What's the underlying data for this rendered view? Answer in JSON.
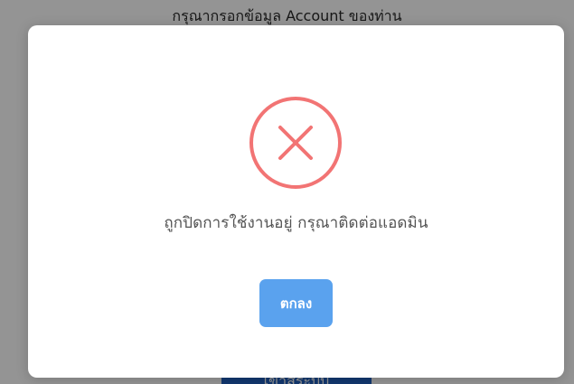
{
  "background_page": {
    "heading": "กรุณากรอกข้อมูล Account ของท่าน",
    "submit_button_label": "เข้าสู่ระบบ"
  },
  "modal": {
    "icon": "error-x-circle-icon",
    "icon_color": "#f27474",
    "message": "ถูกปิดการใช้งานอยู่ กรุณาติดต่อแอดมิน",
    "confirm_button_label": "ตกลง",
    "confirm_button_color": "#5aa2ee"
  }
}
